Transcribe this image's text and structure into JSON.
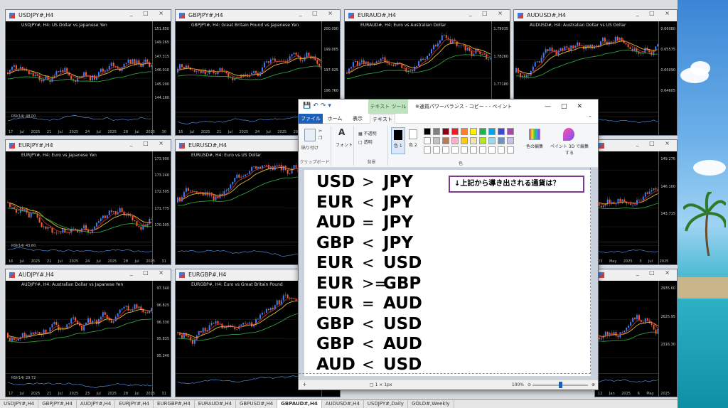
{
  "charts": [
    {
      "title": "USDJPY#,H4",
      "desc": "USDJPY#, H4: US Dollar vs Japanese Yen",
      "prices": [
        "151.850",
        "149.265",
        "147.315",
        "146.010",
        "145.200",
        "144.160"
      ],
      "dates": "17 Jul 2025  21 Jul 2025  24 Jul 2025  28 Jul 2025  30 Jul 2025  1 Aug 00:00",
      "rsi": "RSI(14) 48.00"
    },
    {
      "title": "GBPJPY#,H4",
      "desc": "GBPJPY#, H4: Great Britain Pound vs Japanese Yen",
      "prices": [
        "200.090",
        "199.005",
        "197.925",
        "196.760"
      ],
      "dates": "16 Jul 2025  21 Jul 2025  24 Jul 2025  28 Jul 2025  31 Jul",
      "rsi": ""
    },
    {
      "title": "EURAUD#,H4",
      "desc": "EURAUD#, H4: Euro vs Australian Dollar",
      "prices": [
        "1.79035",
        "1.78260",
        "1.77180"
      ],
      "dates": "",
      "rsi": ""
    },
    {
      "title": "AUDUSD#,H4",
      "desc": "AUDUSD#, H4: Australian Dollar vs US Dollar",
      "prices": [
        "0.66080",
        "0.65575",
        "0.65090",
        "0.64605"
      ],
      "dates": "",
      "rsi": ""
    },
    {
      "title": "EURJPY#,H4",
      "desc": "EURJPY#, H4: Euro vs Japanese Yen",
      "prices": [
        "173.900",
        "173.240",
        "172.505",
        "171.775",
        "170.305"
      ],
      "dates": "16 Jul 2025  21 Jul 2025  24 Jul 2025  28 Jul 2025  31 Jul 2025",
      "rsi": "RSI(14) 43.60"
    },
    {
      "title": "EURUSD#,H4",
      "desc": "EURUSD#, H4: Euro vs US Dollar",
      "prices": [],
      "dates": "",
      "rsi": ""
    },
    {
      "title": "",
      "desc": "",
      "prices": [
        "149.276",
        "146.100",
        "143.715"
      ],
      "dates": "23 May 2025  3 Jul 2025",
      "rsi": ""
    },
    {
      "title": "AUDJPY#,H4",
      "desc": "AUDJPY#, H4: Australian Dollar vs Japanese Yen",
      "prices": [
        "97.340",
        "96.825",
        "96.330",
        "95.835",
        "95.340"
      ],
      "dates": "17 Jul 2025  21 Jul 2025  23 Jul 2025  28 Jul 2025  31 Jul 04:00",
      "rsi": "RSI(14) 29.72"
    },
    {
      "title": "EURGBP#,H4",
      "desc": "EURGBP#, H4: Euro vs Great Britain Pound",
      "prices": [],
      "dates": "",
      "rsi": ""
    },
    {
      "title": "",
      "desc": "",
      "prices": [
        "2935.60",
        "2625.95",
        "2316.30"
      ],
      "dates": "12 Jan 2025  6 May 2025",
      "rsi": ""
    }
  ],
  "tabs": [
    "USDJPY#,H4",
    "GBPJPY#,H4",
    "AUDJPY#,H4",
    "EURJPY#,H4",
    "EURGBP#,H4",
    "EURAUD#,H4",
    "GBPUSD#,H4",
    "GBPAUD#,H4",
    "AUDUSD#,H4",
    "USDJPY#,Daily",
    "GOLD#,Weekly"
  ],
  "active_tab": "GBPAUD#,H4",
  "paint": {
    "context_tool": "テキスト ツール",
    "title": "※通貨パワーバランス - コピー - - ペイント",
    "tabs": [
      "ファイル",
      "ホーム",
      "表示",
      "テキスト"
    ],
    "clipboard_label": "貼り付け",
    "clipboard_group": "クリップボード",
    "font_label": "フォント",
    "opaque_label": "不透明",
    "transparent_label": "透明",
    "bg_group": "背景",
    "color1_label": "色 1",
    "color2_label": "色 2",
    "edit_colors_label": "色の編集",
    "paint3d_label": "ペイント 3D で編集する",
    "colors_group": "色",
    "palette": [
      "#000000",
      "#7f7f7f",
      "#880015",
      "#ed1c24",
      "#ff7f27",
      "#fff200",
      "#22b14c",
      "#00a2e8",
      "#3f48cc",
      "#a349a4",
      "#ffffff",
      "#c3c3c3",
      "#b97a57",
      "#ffaec9",
      "#ffc90e",
      "#efe4b0",
      "#b5e61d",
      "#99d9ea",
      "#7092be",
      "#c8bfe7"
    ],
    "callout": "↓上記から導き出される通貨は？",
    "relations": [
      {
        "lhs": "USD",
        "op": ">",
        "rhs": "JPY"
      },
      {
        "lhs": "EUR",
        "op": "<",
        "rhs": "JPY"
      },
      {
        "lhs": "AUD",
        "op": "=",
        "rhs": "JPY"
      },
      {
        "lhs": "GBP",
        "op": "<",
        "rhs": "JPY"
      },
      {
        "lhs": "EUR",
        "op": "<",
        "rhs": "USD"
      },
      {
        "lhs": "EUR",
        "op": ">=",
        "rhs": "GBP"
      },
      {
        "lhs": "EUR",
        "op": "=",
        "rhs": "AUD"
      },
      {
        "lhs": "GBP",
        "op": "<",
        "rhs": "USD"
      },
      {
        "lhs": "GBP",
        "op": "<",
        "rhs": "AUD"
      },
      {
        "lhs": "AUD",
        "op": "<",
        "rhs": "USD"
      }
    ],
    "status_dims": "1 × 1px",
    "zoom": "100%"
  }
}
